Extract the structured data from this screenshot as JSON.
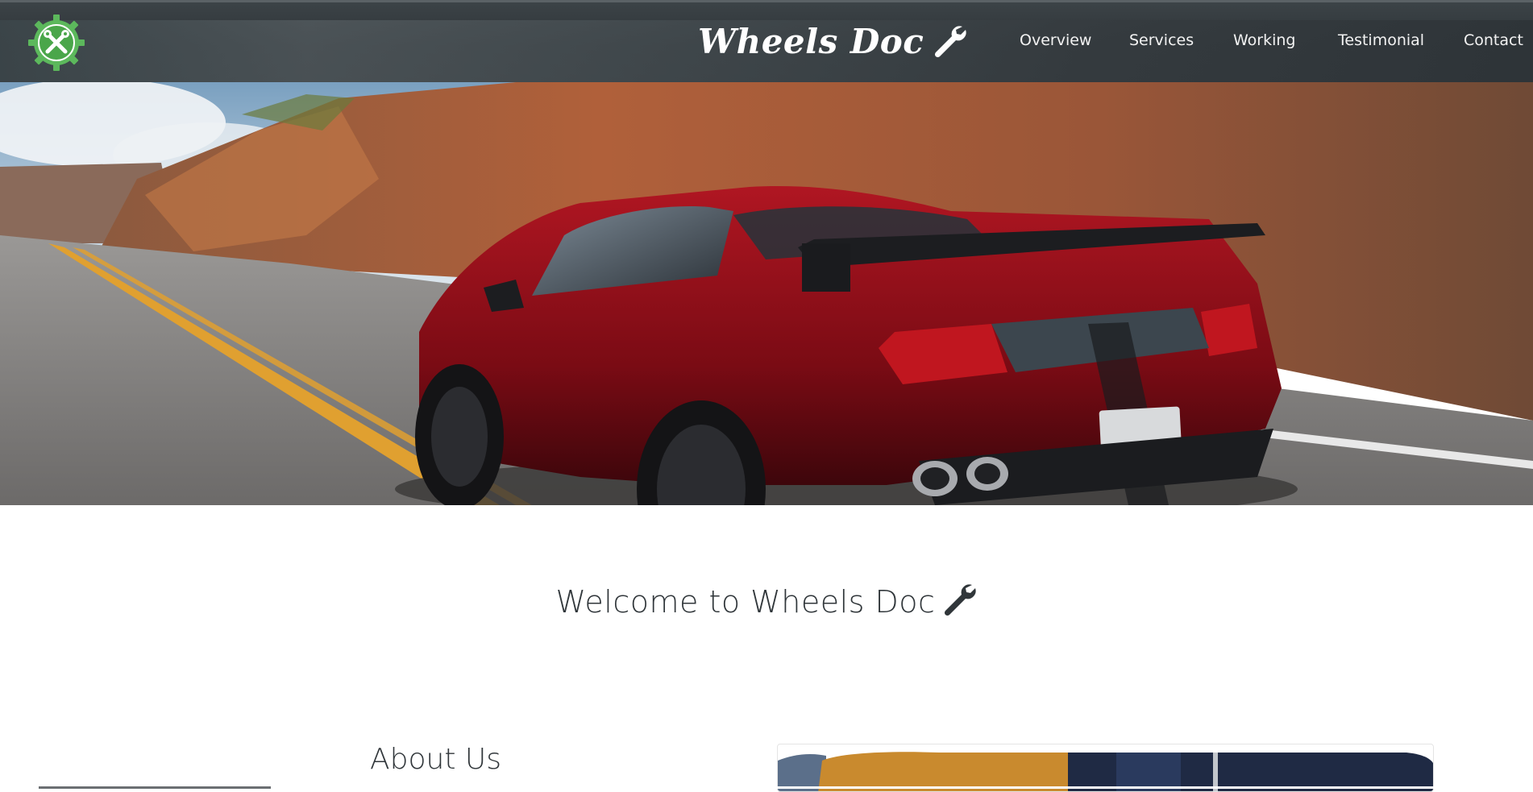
{
  "header": {
    "brand": "Wheels Doc",
    "nav": [
      {
        "label": "Overview"
      },
      {
        "label": "Services"
      },
      {
        "label": "Working"
      },
      {
        "label": "Testimonial"
      },
      {
        "label": "Contact"
      }
    ]
  },
  "logo": {
    "icon": "gear-tools-icon",
    "color": "#5cb85c"
  },
  "hero": {
    "image": "red-sports-car-on-road"
  },
  "welcome": {
    "title": "Welcome to Wheels Doc"
  },
  "about": {
    "title": "About Us",
    "image": "mechanic-photo"
  },
  "colors": {
    "header_bg": "#2f3538",
    "accent_green": "#5cb85c",
    "text_dark": "#30363a"
  }
}
